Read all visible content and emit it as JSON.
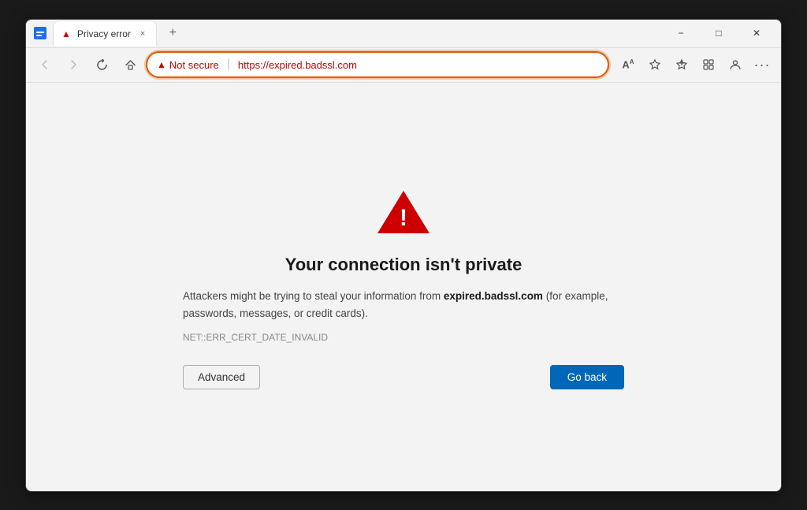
{
  "browser": {
    "tab": {
      "title": "Privacy error",
      "close_label": "×"
    },
    "new_tab_label": "+",
    "window_controls": {
      "minimize": "−",
      "maximize": "□",
      "close": "✕"
    }
  },
  "navbar": {
    "back_tooltip": "Back",
    "forward_tooltip": "Forward",
    "refresh_tooltip": "Refresh",
    "home_tooltip": "Home",
    "address": {
      "warning_text": "Not secure",
      "url": "https://expired.badssl.com"
    },
    "toolbar": {
      "read_aloud": "A",
      "favorites": "☆",
      "add_favorites": "✦",
      "collections": "⊞",
      "profile": "👤",
      "more": "···"
    }
  },
  "page": {
    "icon": "⚠",
    "title": "Your connection isn't private",
    "description_prefix": "Attackers might be trying to steal your information from ",
    "domain": "expired.badssl.com",
    "description_suffix": " (for example, passwords, messages, or credit cards).",
    "error_code": "NET::ERR_CERT_DATE_INVALID",
    "buttons": {
      "advanced": "Advanced",
      "go_back": "Go back"
    }
  }
}
